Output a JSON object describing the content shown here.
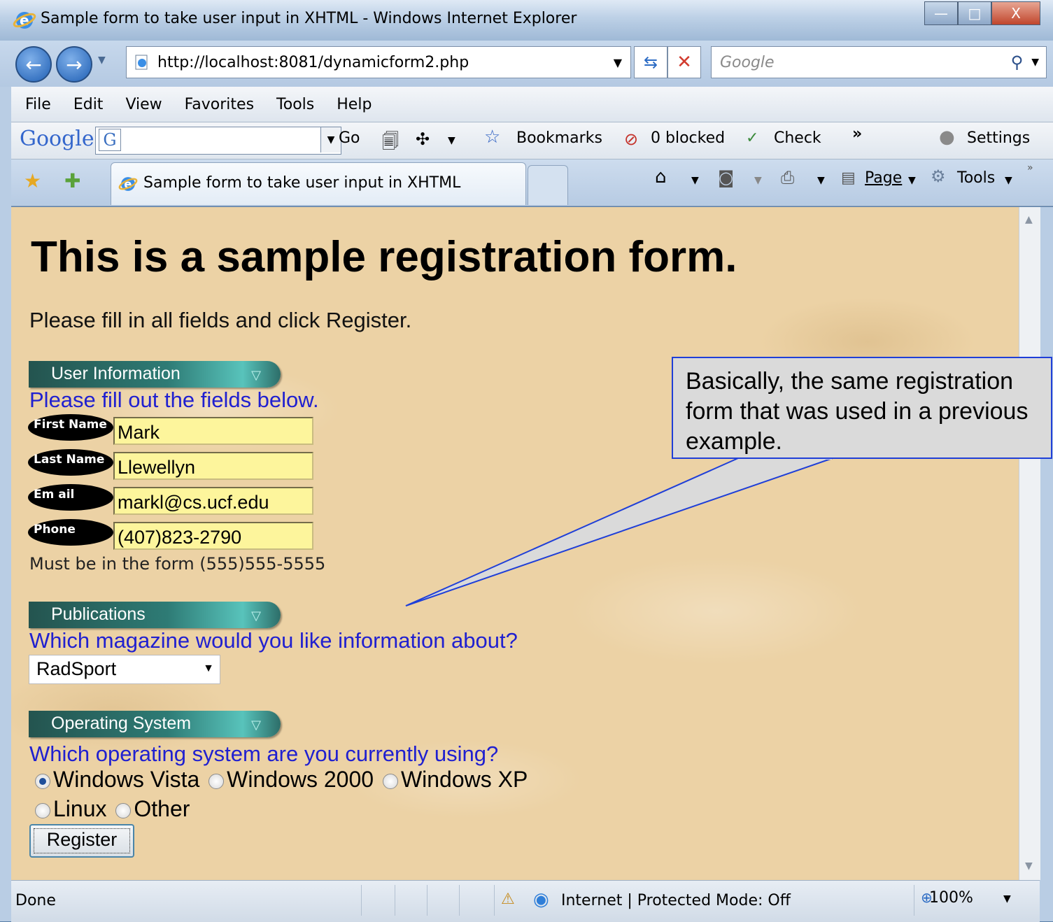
{
  "window": {
    "title": "Sample form to take user input in XHTML - Windows Internet Explorer",
    "controls": {
      "minimize": "—",
      "maximize": "□",
      "close": "X"
    }
  },
  "address_bar": {
    "url": "http://localhost:8081/dynamicform2.php",
    "search_placeholder": "Google"
  },
  "menu": [
    "File",
    "Edit",
    "View",
    "Favorites",
    "Tools",
    "Help"
  ],
  "google_toolbar": {
    "logo": "Google",
    "go_label": "Go",
    "bookmarks_label": "Bookmarks",
    "blocked_label": "0 blocked",
    "check_label": "Check",
    "more_label": "»",
    "settings_label": "Settings"
  },
  "tabs": {
    "active_title": "Sample form to take user input in XHTML",
    "page_label": "Page",
    "tools_label": "Tools"
  },
  "page": {
    "heading": "This is a sample registration form.",
    "intro": "Please fill in all fields and click Register.",
    "user_info": {
      "header": "User Information",
      "prompt": "Please fill out the fields below.",
      "fields": [
        {
          "label": "First Name",
          "value": "Mark"
        },
        {
          "label": "Last Name",
          "value": "Llewellyn"
        },
        {
          "label": "Em ail",
          "value": "markl@cs.ucf.edu"
        },
        {
          "label": "Phone",
          "value": "(407)823-2790"
        }
      ],
      "phone_hint": "Must be in the form (555)555-5555"
    },
    "publications": {
      "header": "Publications",
      "prompt": "Which magazine would you like information about?",
      "selected": "RadSport"
    },
    "os": {
      "header": "Operating System",
      "prompt": "Which operating system are you currently using?",
      "options": [
        {
          "label": "Windows Vista",
          "checked": true
        },
        {
          "label": "Windows 2000",
          "checked": false
        },
        {
          "label": "Windows XP",
          "checked": false
        },
        {
          "label": "Linux",
          "checked": false
        },
        {
          "label": "Other",
          "checked": false
        }
      ]
    },
    "register_label": "Register"
  },
  "callout": {
    "text": "Basically, the same registration form that was used in a previous example."
  },
  "status_bar": {
    "left": "Done",
    "zone": "Internet | Protected Mode: Off",
    "zoom": "100%"
  },
  "colors": {
    "page_background": "#ecd2a5",
    "prompt_blue": "#2020d0",
    "input_fill": "#fdf59c",
    "callout_border": "#1f3fd8"
  }
}
